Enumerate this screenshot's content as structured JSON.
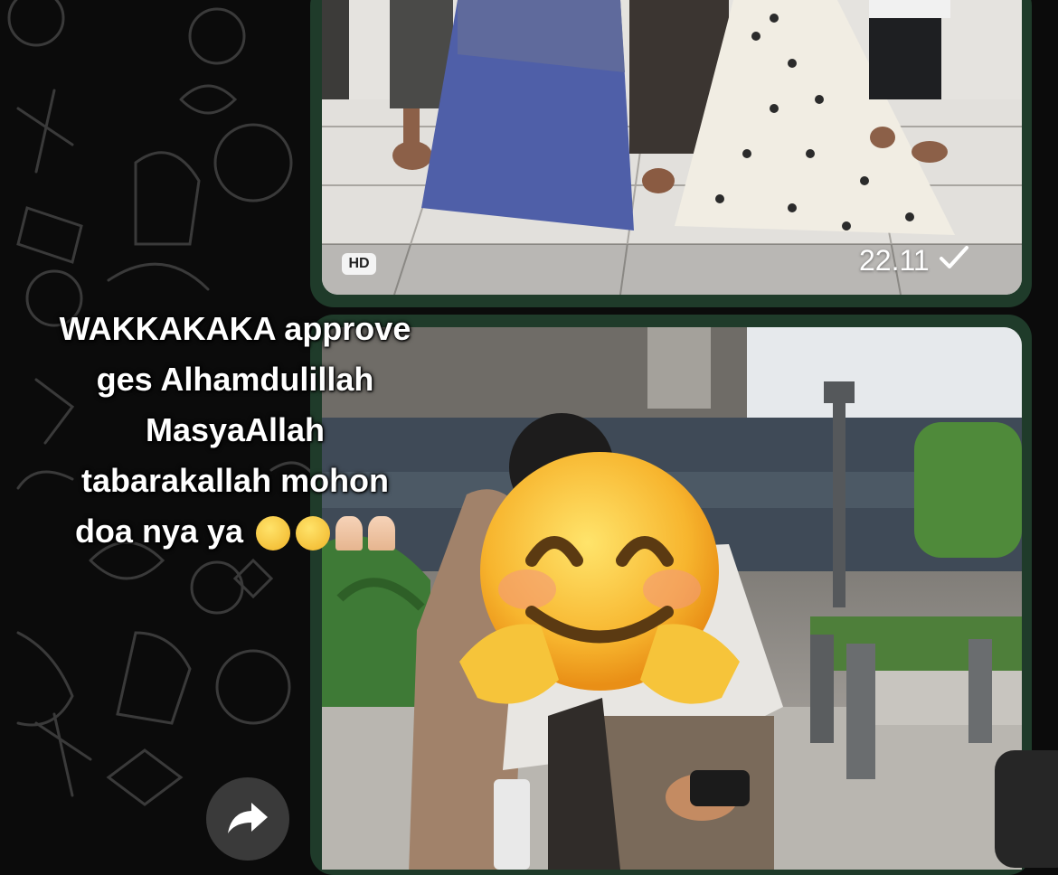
{
  "messages": [
    {
      "type": "photo",
      "badge": "HD",
      "time": "22.11",
      "status": "sent"
    },
    {
      "type": "photo",
      "caption_overlay": {
        "line1": "WAKKAKAKA approve",
        "line2": "ges Alhamdulillah",
        "line3": "MasyaAllah",
        "line4": "tabarakallah mohon",
        "line5": "doa nya ya"
      }
    }
  ],
  "icons": {
    "check": "check-icon",
    "forward": "forward-icon",
    "face": "smiling-face-emoji"
  },
  "colors": {
    "bubble_border": "#1f3b2a",
    "background": "#0b0b0b"
  }
}
